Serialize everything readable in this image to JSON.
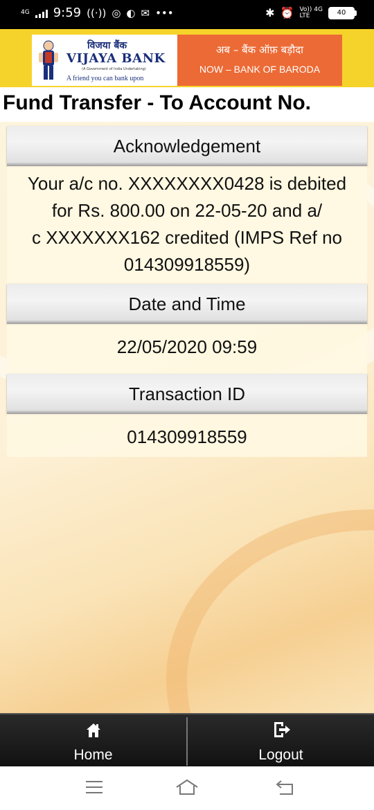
{
  "status_bar": {
    "time": "9:59",
    "network_left": "4G",
    "icons_left": [
      "signal-icon",
      "hotspot-icon",
      "whatsapp-icon",
      "app-icon",
      "mail-icon",
      "more-icon"
    ],
    "more": "•••",
    "network_right_top": "Vo)) 4G",
    "network_right_bottom": "LTE",
    "battery": "40"
  },
  "banner": {
    "hindi_name": "विजया बैंक",
    "bank_name": "VIJAYA BANK",
    "govt_line": "(A Government of India Undertaking)",
    "tagline": "A friend you can bank upon",
    "merge_hindi": "अब – बैंक ऑफ़ बड़ौदा",
    "merge_english": "NOW – BANK OF BARODA"
  },
  "page_title": "Fund Transfer - To Account No.",
  "sections": [
    {
      "heading": "Acknowledgement",
      "lines": [
        "Your a/c no. XXXXXXXX0428 is debited",
        "for Rs. 800.00 on 22-05-20 and a/",
        "c XXXXXXX162 credited (IMPS Ref no",
        "014309918559)"
      ]
    },
    {
      "heading": "Date and Time",
      "lines": [
        "22/05/2020 09:59"
      ]
    },
    {
      "heading": "Transaction ID",
      "lines": [
        "014309918559"
      ]
    }
  ],
  "bottom_nav": {
    "home": "Home",
    "logout": "Logout"
  },
  "colors": {
    "banner_yellow": "#f6d32a",
    "baroda_orange": "#ec6a35",
    "vijaya_blue": "#1b2f7a"
  }
}
